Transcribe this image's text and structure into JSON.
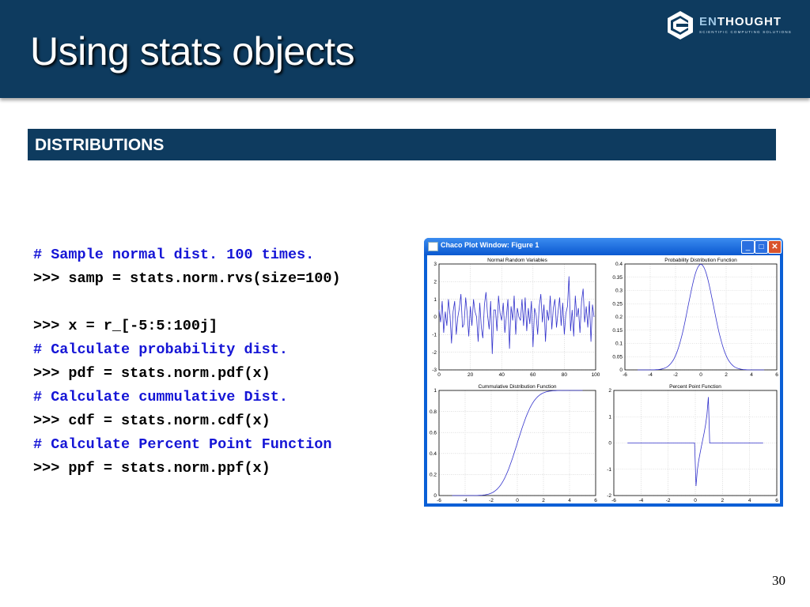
{
  "slide": {
    "title": "Using stats objects",
    "section": "DISTRIBUTIONS",
    "page_number": "30"
  },
  "logo": {
    "word_prefix": "EN",
    "word_suffix": "THOUGHT",
    "tagline": "SCIENTIFIC COMPUTING SOLUTIONS",
    "icon": "enthought-e-logo"
  },
  "code": [
    {
      "kind": "comment",
      "text": "# Sample normal dist. 100 times."
    },
    {
      "kind": "cmd",
      "text": ">>> samp = stats.norm.rvs(size=100)"
    },
    {
      "kind": "blank",
      "text": ""
    },
    {
      "kind": "cmd",
      "text": ">>> x = r_[-5:5:100j]"
    },
    {
      "kind": "comment",
      "text": "# Calculate probability dist."
    },
    {
      "kind": "cmd",
      "text": ">>> pdf = stats.norm.pdf(x)"
    },
    {
      "kind": "comment",
      "text": "# Calculate cummulative Dist."
    },
    {
      "kind": "cmd",
      "text": ">>> cdf = stats.norm.cdf(x)"
    },
    {
      "kind": "comment",
      "text": "# Calculate Percent Point Function"
    },
    {
      "kind": "cmd",
      "text": ">>> ppf = stats.norm.ppf(x)"
    }
  ],
  "window": {
    "title": "Chaco Plot Window: Figure 1",
    "minimize_icon": "minimize-icon",
    "maximize_icon": "maximize-icon",
    "close_icon": "close-icon",
    "colors": {
      "titlebar": "#0a58d0",
      "line": "#3333cc",
      "grid": "#c8c8c8"
    }
  },
  "chart_data": [
    {
      "type": "line",
      "title": "Normal Random Variables",
      "xlim": [
        0,
        100
      ],
      "ylim": [
        -3,
        3
      ],
      "xticks": [
        "0",
        "20",
        "40",
        "60",
        "80",
        "100"
      ],
      "yticks": [
        "-3",
        "-2",
        "-1",
        "0",
        "1",
        "2",
        "3"
      ],
      "grid": true,
      "values": [
        0.4,
        -0.3,
        0.9,
        -0.9,
        0.3,
        -0.5,
        1.0,
        0.1,
        -1.5,
        0.3,
        0.9,
        -1.0,
        0.0,
        0.5,
        1.3,
        -0.6,
        -0.4,
        1.1,
        0.2,
        -1.1,
        0.6,
        -0.5,
        1.0,
        0.3,
        0.0,
        -1.4,
        0.8,
        -0.6,
        -1.2,
        0.7,
        1.4,
        0.1,
        -0.7,
        0.9,
        -2.1,
        0.4,
        0.4,
        -0.8,
        1.2,
        0.2,
        -0.2,
        0.8,
        -0.9,
        0.0,
        1.0,
        -1.8,
        0.6,
        -0.2,
        1.2,
        -1.0,
        0.5,
        0.0,
        -0.2,
        1.0,
        -0.5,
        1.1,
        -0.8,
        0.5,
        -0.4,
        0.9,
        -1.7,
        0.5,
        0.1,
        -1.0,
        0.6,
        1.3,
        -0.3,
        0.7,
        -1.4,
        0.4,
        -0.2,
        1.2,
        -0.7,
        0.5,
        1.0,
        -0.6,
        0.3,
        1.1,
        -0.5,
        0.8,
        -1.0,
        0.2,
        0.6,
        2.3,
        -0.8,
        0.4,
        -1.1,
        1.2,
        0.0,
        0.5,
        -0.9,
        0.9,
        1.6,
        -0.3,
        0.6,
        -0.6,
        0.9,
        -1.4,
        0.7,
        0.0
      ]
    },
    {
      "type": "line",
      "title": "Probability Distribution Function",
      "xlim": [
        -6,
        6
      ],
      "ylim": [
        0,
        0.4
      ],
      "xticks": [
        "-6",
        "-4",
        "-2",
        "0",
        "2",
        "4",
        "6"
      ],
      "yticks": [
        "0",
        "0.05",
        "0.1",
        "0.15",
        "0.2",
        "0.25",
        "0.3",
        "0.35",
        "0.4"
      ],
      "grid": true,
      "function": "normal pdf on x from -5 to 5"
    },
    {
      "type": "line",
      "title": "Cummulative Distribution Function",
      "xlim": [
        -6,
        6
      ],
      "ylim": [
        0,
        1
      ],
      "xticks": [
        "-6",
        "-4",
        "-2",
        "0",
        "2",
        "4",
        "6"
      ],
      "yticks": [
        "0",
        "0.2",
        "0.4",
        "0.6",
        "0.8",
        "1"
      ],
      "grid": true,
      "function": "normal cdf on x from -5 to 5"
    },
    {
      "type": "line",
      "title": "Percent Point Function",
      "xlim": [
        -6,
        6
      ],
      "ylim": [
        -2,
        2
      ],
      "xticks": [
        "-6",
        "-4",
        "-2",
        "0",
        "2",
        "4",
        "6"
      ],
      "yticks": [
        "-2",
        "-1",
        "0",
        "1",
        "2"
      ],
      "grid": true,
      "function": "normal ppf, 0 outside (0,1), spikes near x=0 and x=1"
    }
  ]
}
